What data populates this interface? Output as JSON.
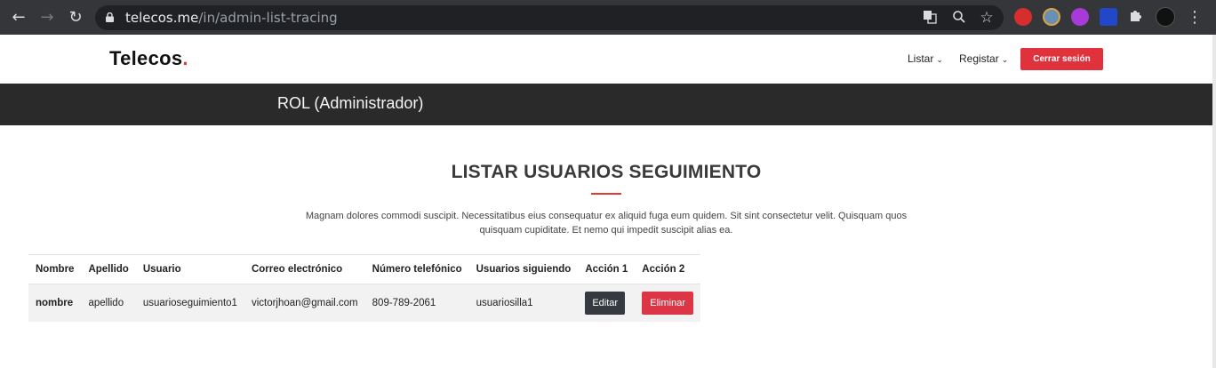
{
  "browser": {
    "url_host": "telecos.me",
    "url_path": "/in/admin-list-tracing",
    "icons": [
      "back-icon",
      "forward-icon",
      "reload-icon",
      "lock-icon",
      "translate-icon",
      "zoom-icon",
      "bookmark-star-icon",
      "extension-icon",
      "profile-avatar",
      "more-icon"
    ]
  },
  "header": {
    "logo_text": "Telecos",
    "logo_dot": ".",
    "menu": [
      {
        "label": "Listar"
      },
      {
        "label": "Registar"
      }
    ],
    "logout_label": "Cerrar sesión"
  },
  "role_bar": {
    "text": "ROL (Administrador)"
  },
  "main": {
    "title": "LISTAR USUARIOS SEGUIMIENTO",
    "description": "Magnam dolores commodi suscipit. Necessitatibus eius consequatur ex aliquid fuga eum quidem. Sit sint consectetur velit. Quisquam quos quisquam cupiditate. Et nemo qui impedit suscipit alias ea.",
    "table": {
      "headers": [
        "Nombre",
        "Apellido",
        "Usuario",
        "Correo electrónico",
        "Número telefónico",
        "Usuarios siguiendo",
        "Acción 1",
        "Acción 2"
      ],
      "rows": [
        {
          "nombre": "nombre",
          "apellido": "apellido",
          "usuario": "usuarioseguimiento1",
          "correo": "victorjhoan@gmail.com",
          "telefono": "809-789-2061",
          "siguiendo": "usuariosilla1",
          "edit_label": "Editar",
          "delete_label": "Eliminar"
        }
      ]
    }
  },
  "colors": {
    "accent_red": "#e0323c",
    "dark_bar": "#2a2a2a"
  }
}
